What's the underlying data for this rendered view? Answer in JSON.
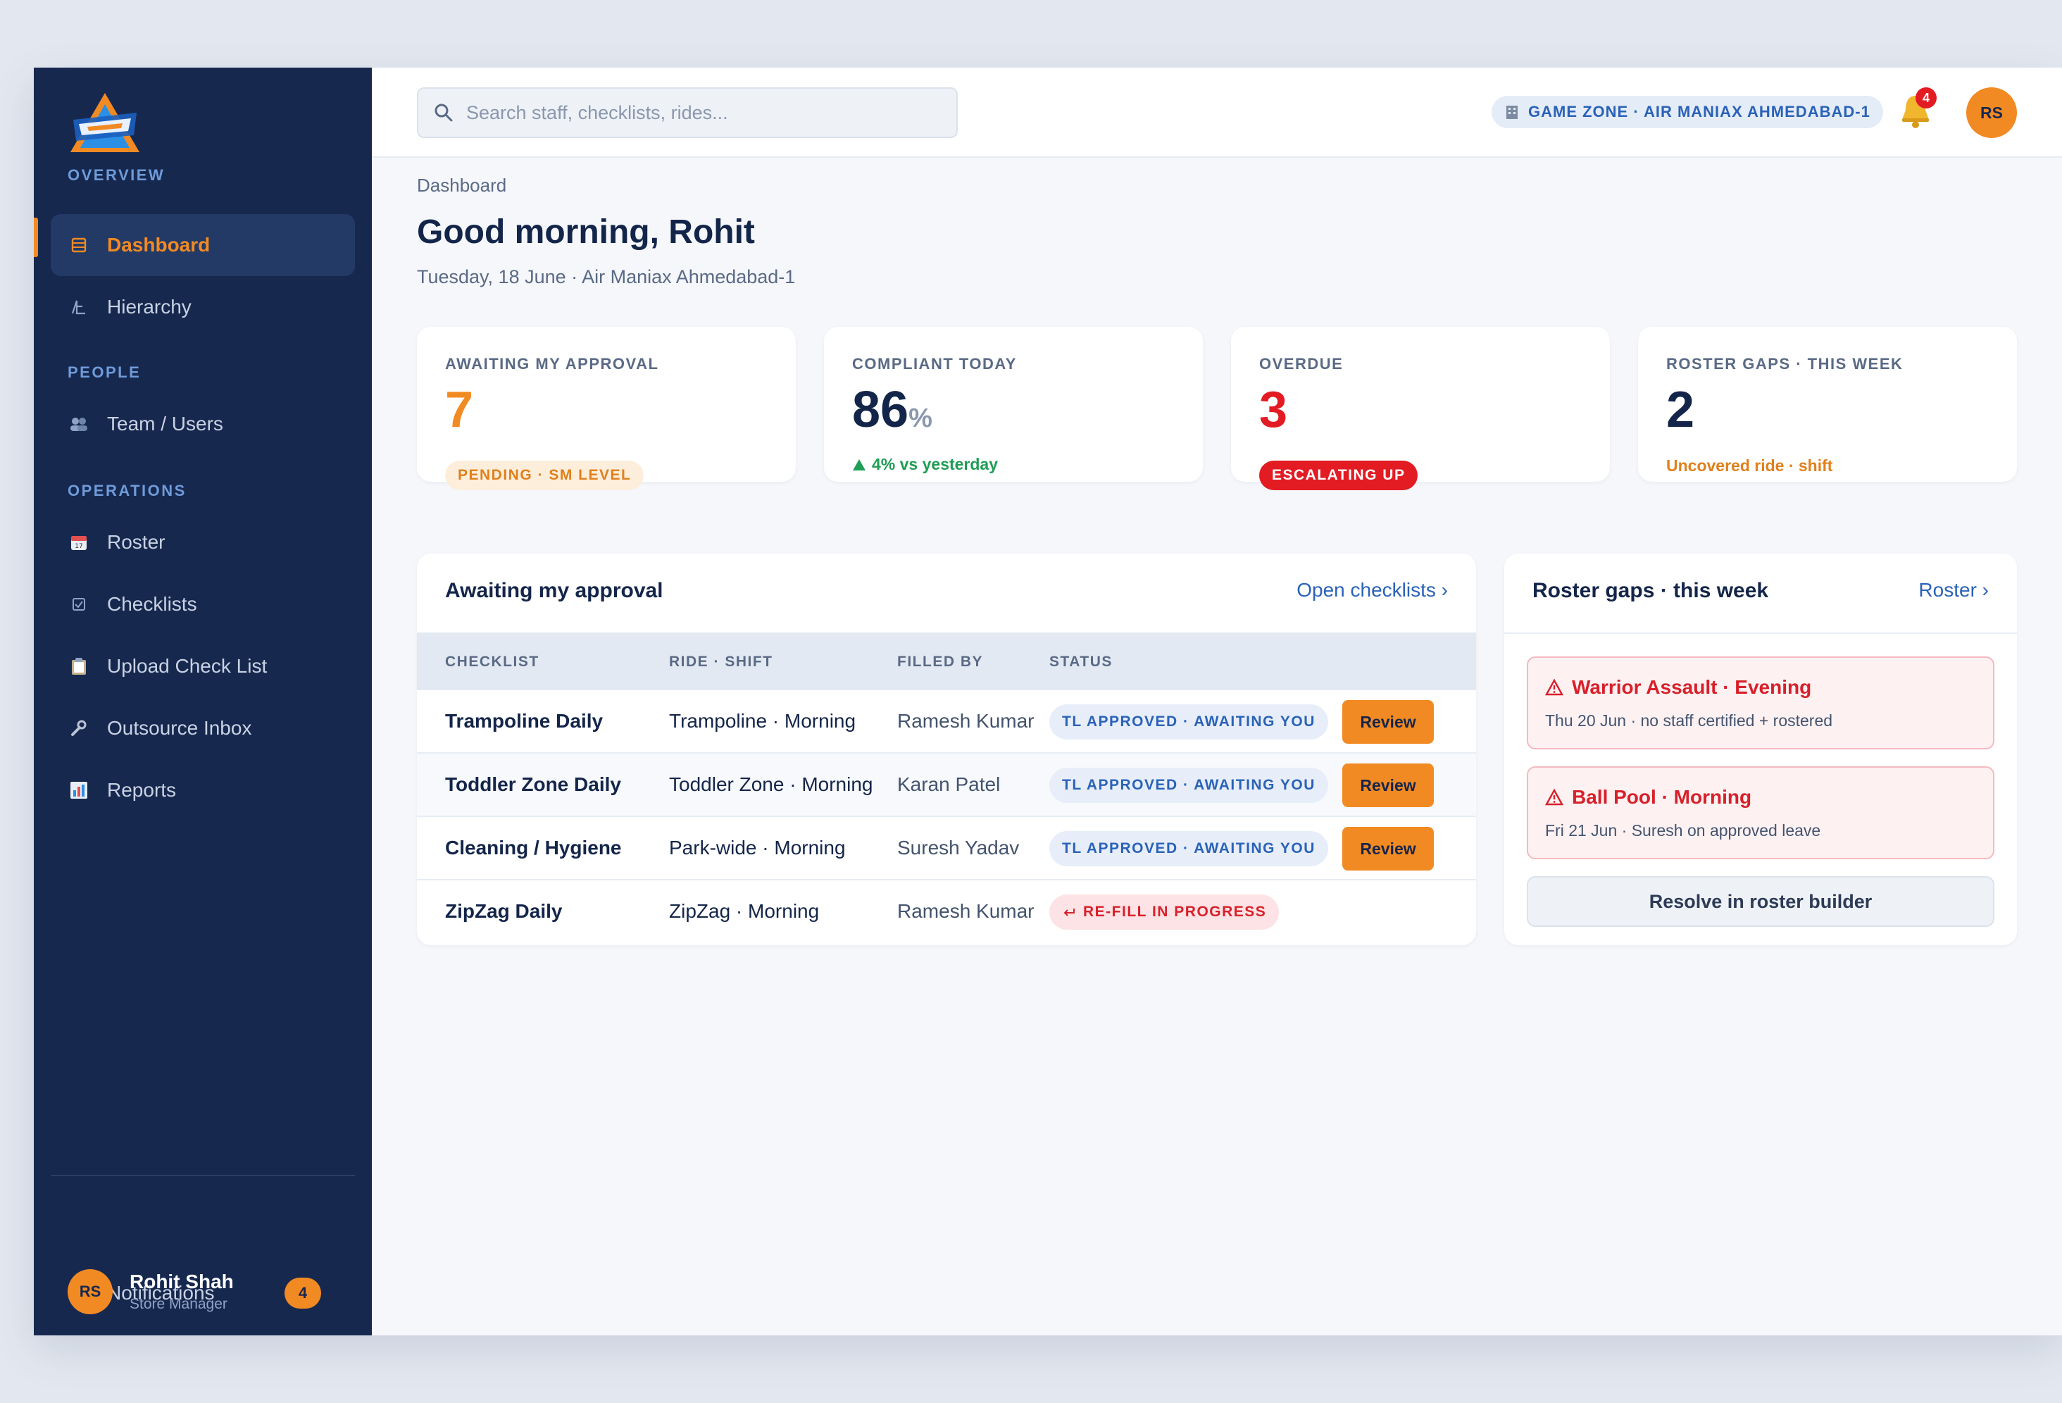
{
  "sidebar": {
    "sections": {
      "overview": "OVERVIEW",
      "people": "PEOPLE",
      "operations": "OPERATIONS"
    },
    "items": {
      "dashboard": "Dashboard",
      "hierarchy": "Hierarchy",
      "team": "Team / Users",
      "roster": "Roster",
      "checklists": "Checklists",
      "upload": "Upload Check List",
      "outsource": "Outsource Inbox",
      "reports": "Reports"
    },
    "notifications": {
      "label": "Notifications",
      "count": "4"
    },
    "user": {
      "initials": "RS",
      "name": "Rohit Shah",
      "role": "Store Manager"
    }
  },
  "topbar": {
    "search_placeholder": "Search staff, checklists, rides...",
    "location": "GAME ZONE · AIR MANIAX AHMEDABAD-1",
    "bell_count": "4",
    "avatar_initials": "RS"
  },
  "page": {
    "breadcrumb": "Dashboard",
    "greeting": "Good morning, Rohit",
    "date_line": "Tuesday, 18 June · Air Maniax Ahmedabad-1"
  },
  "kpis": {
    "approval": {
      "label": "AWAITING MY APPROVAL",
      "value": "7",
      "chip": "PENDING · SM LEVEL"
    },
    "compliant": {
      "label": "COMPLIANT TODAY",
      "value": "86",
      "unit": "%",
      "note": "4% vs yesterday"
    },
    "overdue": {
      "label": "OVERDUE",
      "value": "3",
      "chip": "ESCALATING UP"
    },
    "roster": {
      "label": "ROSTER GAPS · THIS WEEK",
      "value": "2",
      "note": "Uncovered ride · shift"
    }
  },
  "approvals": {
    "title": "Awaiting my approval",
    "link": "Open checklists ›",
    "columns": {
      "checklist": "CHECKLIST",
      "ride": "RIDE · SHIFT",
      "filled_by": "FILLED BY",
      "status": "STATUS"
    },
    "rows": [
      {
        "checklist": "Trampoline Daily",
        "ride": "Trampoline · Morning",
        "filled_by": "Ramesh Kumar",
        "status": "TL APPROVED · AWAITING YOU",
        "action": "Review"
      },
      {
        "checklist": "Toddler Zone Daily",
        "ride": "Toddler Zone · Morning",
        "filled_by": "Karan Patel",
        "status": "TL APPROVED · AWAITING YOU",
        "action": "Review"
      },
      {
        "checklist": "Cleaning / Hygiene",
        "ride": "Park-wide · Morning",
        "filled_by": "Suresh Yadav",
        "status": "TL APPROVED · AWAITING YOU",
        "action": "Review"
      },
      {
        "checklist": "ZipZag Daily",
        "ride": "ZipZag · Morning",
        "filled_by": "Ramesh Kumar",
        "status": "RE-FILL IN PROGRESS"
      }
    ]
  },
  "roster_gaps": {
    "title": "Roster gaps · this week",
    "link": "Roster ›",
    "items": [
      {
        "title": "Warrior Assault · Evening",
        "detail": "Thu 20 Jun · no staff certified + rostered"
      },
      {
        "title": "Ball Pool · Morning",
        "detail": "Fri 21 Jun · Suresh on approved leave"
      }
    ],
    "button": "Resolve in roster builder"
  },
  "colors": {
    "sidebar": "#17284f",
    "accent": "#f28a23",
    "danger": "#e31b23",
    "link": "#2a62b8",
    "success": "#1f9d55"
  },
  "icons": [
    "search-icon",
    "bell-icon",
    "building-icon",
    "grid-icon",
    "hierarchy-icon",
    "users-icon",
    "calendar-icon",
    "checkbox-icon",
    "clipboard-icon",
    "wrench-icon",
    "bar-chart-icon",
    "warning-icon",
    "undo-icon",
    "trend-up-icon"
  ]
}
